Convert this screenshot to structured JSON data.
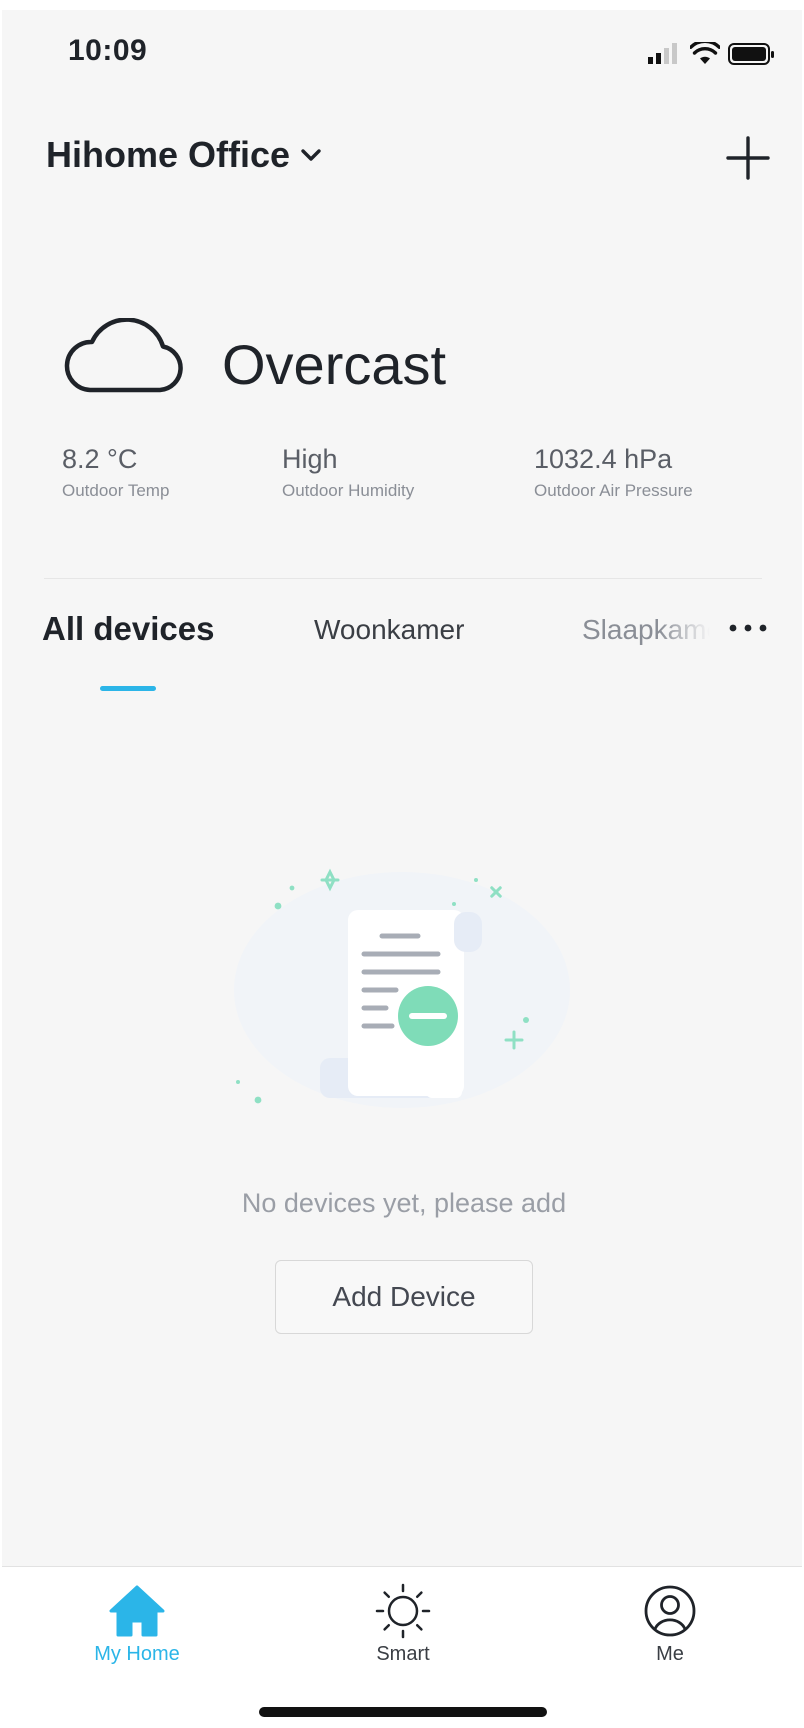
{
  "status_bar": {
    "time": "10:09",
    "icons": [
      "signal-icon",
      "wifi-icon",
      "battery-icon"
    ]
  },
  "header": {
    "home_name": "Hihome Office",
    "icons": [
      "chevron-down-icon",
      "plus-icon"
    ]
  },
  "weather": {
    "icon": "cloud-icon",
    "condition": "Overcast",
    "stats": [
      {
        "value": "8.2 °C",
        "label": "Outdoor Temp"
      },
      {
        "value": "High",
        "label": "Outdoor Humidity"
      },
      {
        "value": "1032.4 hPa",
        "label": "Outdoor Air Pressure"
      }
    ]
  },
  "tabs": {
    "items": [
      {
        "label": "All devices",
        "active": true
      },
      {
        "label": "Woonkamer",
        "active": false
      },
      {
        "label": "Slaapkamer",
        "active": false
      }
    ],
    "more_icon": "more-dots-icon"
  },
  "empty_state": {
    "illustration": "empty-document-icon",
    "message": "No devices yet, please add",
    "button_label": "Add Device"
  },
  "bottom_nav": {
    "items": [
      {
        "label": "My Home",
        "icon": "home-icon",
        "active": true
      },
      {
        "label": "Smart",
        "icon": "sun-icon",
        "active": false
      },
      {
        "label": "Me",
        "icon": "user-icon",
        "active": false
      }
    ]
  },
  "colors": {
    "accent": "#2bb5e8",
    "background": "#f6f6f6",
    "illustration_green": "#7fdcb8"
  }
}
